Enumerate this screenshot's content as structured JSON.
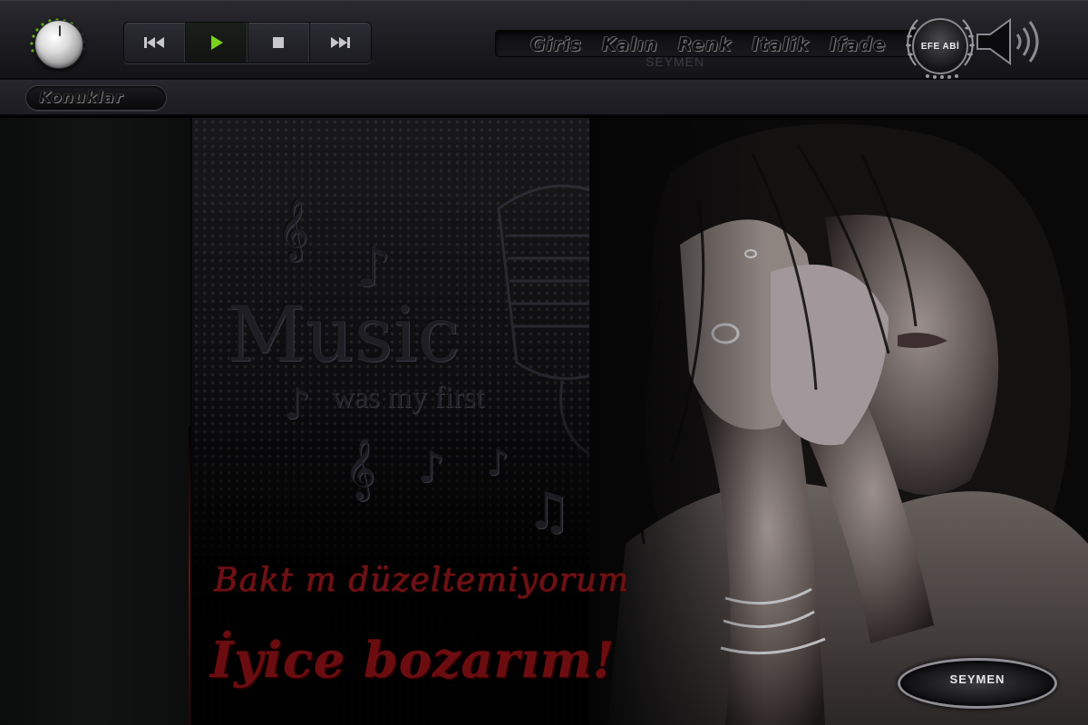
{
  "player": {
    "volume_icon": "volume-knob-icon",
    "transport": [
      {
        "name": "previous",
        "icon": "skip-back-icon"
      },
      {
        "name": "play",
        "icon": "play-icon",
        "active": true
      },
      {
        "name": "stop",
        "icon": "stop-icon"
      },
      {
        "name": "next",
        "icon": "skip-forward-icon"
      }
    ],
    "accent_color": "#7ad11f"
  },
  "menu": {
    "items": [
      "Giris",
      "Kalın",
      "Renk",
      "Italik",
      "Ifade"
    ],
    "watermark": "SEYMEN"
  },
  "badge": {
    "label": "EFE ABİ"
  },
  "sidebar": {
    "guests_label": "Konuklar"
  },
  "stage": {
    "music_title": "Music",
    "music_subtitle": "was my first",
    "script_line1": "Bakt m düzeltemiyorum",
    "script_line2": "İyice bozarım!",
    "logo_label": "SEYMEN",
    "script_color": "#6b0d10"
  }
}
